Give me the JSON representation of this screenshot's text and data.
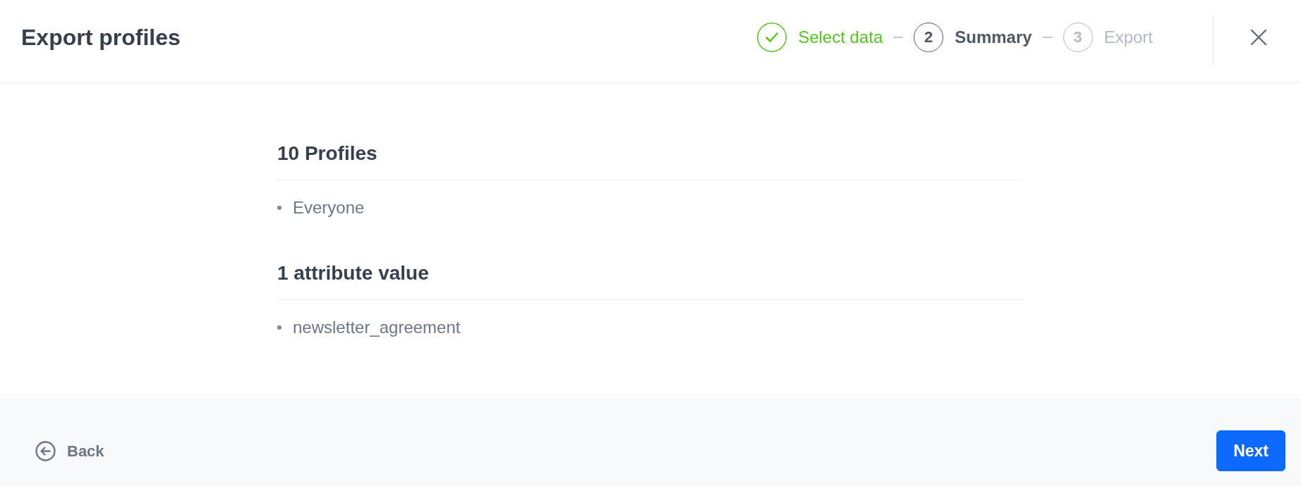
{
  "dialog": {
    "title": "Export profiles"
  },
  "steps": [
    {
      "label": "Select data",
      "done": true,
      "current": false
    },
    {
      "number": "2",
      "label": "Summary",
      "done": false,
      "current": true
    },
    {
      "number": "3",
      "label": "Export",
      "done": false,
      "current": false
    }
  ],
  "sections": [
    {
      "title": "10 Profiles",
      "items": [
        "Everyone"
      ]
    },
    {
      "title": "1 attribute value",
      "items": [
        "newsletter_agreement"
      ]
    }
  ],
  "footer": {
    "back_button": {
      "label": "Back"
    },
    "next_button": {
      "label": "Next"
    }
  }
}
